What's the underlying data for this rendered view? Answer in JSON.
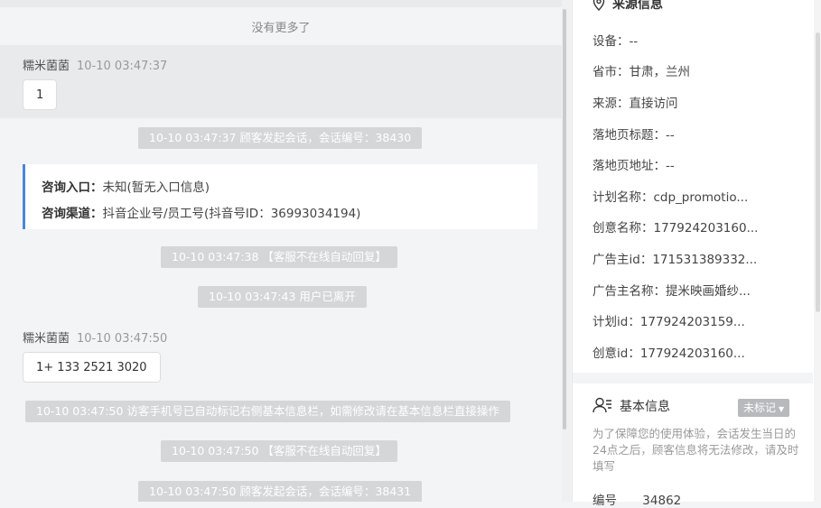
{
  "chat": {
    "no_more": "没有更多了",
    "messages": [
      {
        "sender": "糯米菌菌",
        "time": "10-10 03:47:37",
        "text": "1"
      },
      {
        "sender": "糯米菌菌",
        "time": "10-10 03:47:50",
        "text": "1+ 133 2521 3020"
      }
    ],
    "system": [
      "10-10 03:47:37 顾客发起会话，会话编号：38430",
      "10-10 03:47:38 【客服不在线自动回复】",
      "10-10 03:47:43 用户已离开",
      "10-10 03:47:50 访客手机号已自动标记右侧基本信息栏，如需修改请在基本信息栏直接操作",
      "10-10 03:47:50 【客服不在线自动回复】",
      "10-10 03:47:50 顾客发起会话，会话编号：38431"
    ],
    "consult": {
      "entry_label": "咨询入口：",
      "entry_value": "未知(暂无入口信息)",
      "channel_label": "咨询渠道：",
      "channel_value": "抖音企业号/员工号(抖音号ID：36993034194)"
    }
  },
  "panel": {
    "source_title": "来源信息",
    "rows": [
      "设备：--",
      "省市：甘肃，兰州",
      "来源：直接访问",
      "落地页标题：--",
      "落地页地址：--",
      "计划名称：cdp_promotio...",
      "创意名称：177924203160...",
      "广告主id：171531389332...",
      "广告主名称：提米映画婚纱...",
      "计划id：177924203159...",
      "创意id：177924203160..."
    ],
    "basic_title": "基本信息",
    "tag": "未标记",
    "notice": "为了保障您的使用体验，会话发生当日的24点之后，顾客信息将无法修改，请及时填写",
    "id_label": "编号",
    "id_value": "34862"
  }
}
